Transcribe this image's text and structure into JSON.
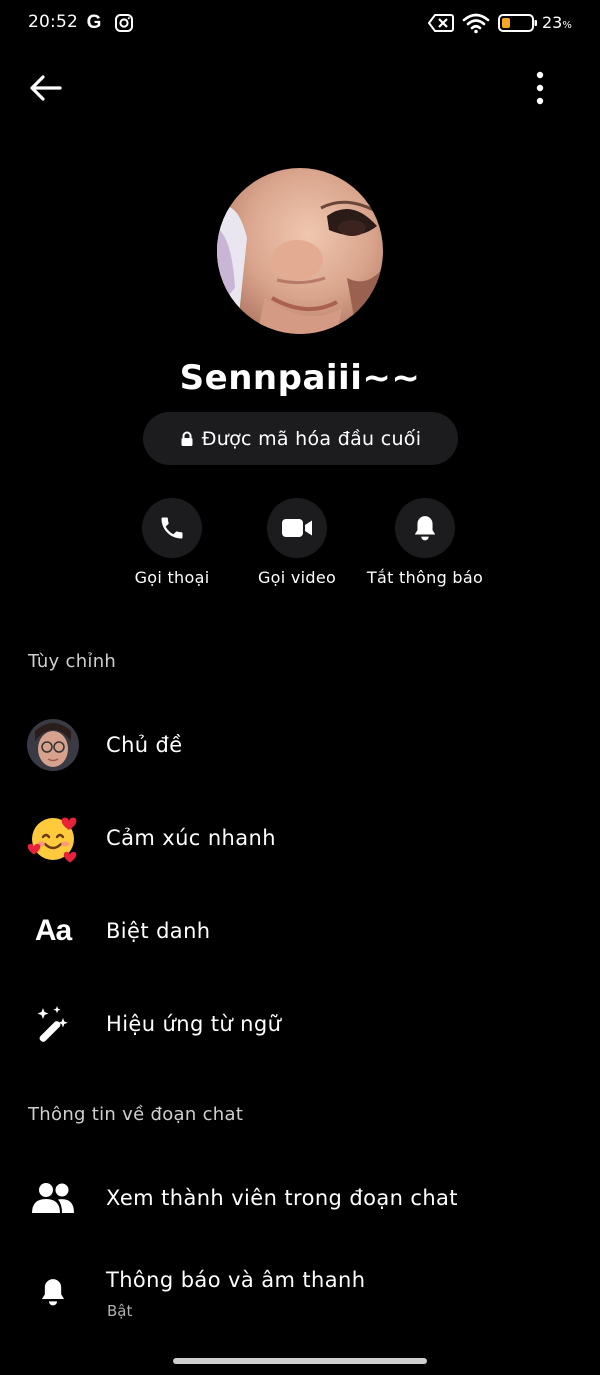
{
  "status_bar": {
    "time": "20:52",
    "battery_level": "23",
    "battery_unit": "%",
    "icons": [
      "google-icon",
      "instagram-icon",
      "no-sim-icon",
      "wifi-icon",
      "battery-icon"
    ]
  },
  "profile": {
    "name": "Sennpaiii~~",
    "encryption_label": "Được mã hóa đầu cuối"
  },
  "actions": [
    {
      "label": "Gọi thoại",
      "icon": "phone-icon"
    },
    {
      "label": "Gọi video",
      "icon": "video-camera-icon"
    },
    {
      "label": "Tắt thông báo",
      "icon": "bell-icon"
    }
  ],
  "sections": {
    "customize": {
      "title": "Tùy chỉnh",
      "items": [
        {
          "label": "Chủ đề",
          "icon": "theme-avatar-icon"
        },
        {
          "label": "Cảm xúc nhanh",
          "icon": "smiling-face-with-hearts-icon"
        },
        {
          "label": "Biệt danh",
          "icon": "text-aa-icon",
          "glyph": "Aa"
        },
        {
          "label": "Hiệu ứng từ ngữ",
          "icon": "magic-wand-icon"
        }
      ]
    },
    "chat_info": {
      "title": "Thông tin về đoạn chat",
      "items": [
        {
          "label": "Xem thành viên trong đoạn chat",
          "icon": "people-icon"
        },
        {
          "label": "Thông báo và âm thanh",
          "sublabel": "Bật",
          "icon": "bell-icon"
        }
      ]
    }
  },
  "colors": {
    "background": "#000000",
    "surface": "#1c1c1e",
    "text_primary": "#ffffff",
    "text_secondary": "#cfcfcf",
    "battery_fill": "#f5a623"
  }
}
